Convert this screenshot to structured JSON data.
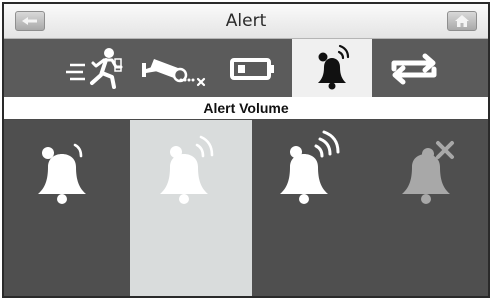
{
  "header": {
    "title": "Alert",
    "back_icon": "back-icon",
    "home_icon": "home-icon"
  },
  "tabs": [
    {
      "icon": "motion-detection-icon",
      "active": false
    },
    {
      "icon": "camera-signal-lost-icon",
      "active": false
    },
    {
      "icon": "low-battery-icon",
      "active": false
    },
    {
      "icon": "alert-volume-bell-icon",
      "active": true
    },
    {
      "icon": "swap-arrows-icon",
      "active": false
    }
  ],
  "section": {
    "label": "Alert Volume"
  },
  "volume_options": [
    {
      "icon": "bell-low-volume-icon",
      "level": 1,
      "selected": false
    },
    {
      "icon": "bell-medium-volume-icon",
      "level": 2,
      "selected": true
    },
    {
      "icon": "bell-high-volume-icon",
      "level": 3,
      "selected": false
    },
    {
      "icon": "bell-mute-icon",
      "level": 0,
      "selected": false
    }
  ],
  "colors": {
    "panel_dark": "#4f4f4f",
    "tab_bar": "#5b5b5b",
    "selected_bg": "#d9dcdc",
    "icon_white": "#ffffff",
    "icon_muted": "#a8a8a8"
  }
}
